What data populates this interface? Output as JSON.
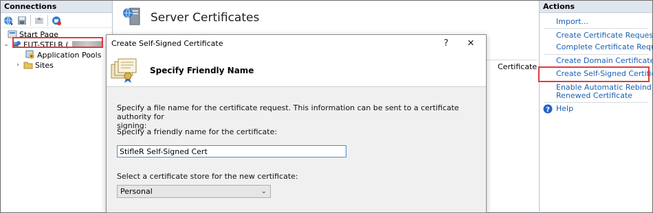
{
  "connections": {
    "header": "Connections",
    "tree": [
      {
        "label": "Start Page"
      },
      {
        "label": "FUT-STFLR ("
      },
      {
        "label": "Application Pools"
      },
      {
        "label": "Sites"
      }
    ]
  },
  "center": {
    "title": "Server Certificates",
    "column_header": "Certificate"
  },
  "actions": {
    "header": "Actions",
    "items": [
      {
        "label": "Import..."
      },
      {
        "label": "Create Certificate Request..."
      },
      {
        "label": "Complete Certificate Request..."
      },
      {
        "label": "Create Domain Certificate..."
      },
      {
        "label": "Create Self-Signed Certificate..."
      },
      {
        "label_line1": "Enable Automatic Rebind of",
        "label_line2": "Renewed Certificate"
      },
      {
        "label": "Help"
      }
    ]
  },
  "dialog": {
    "title": "Create Self-Signed Certificate",
    "help_glyph": "?",
    "close_glyph": "✕",
    "header": "Specify Friendly Name",
    "description_line1": "Specify a file name for the certificate request.  This information can be sent to a certificate authority for",
    "description_line2": "signing:",
    "friendly_name_label": "Specify a friendly name for the certificate:",
    "friendly_name_value": "StifleR Self-Signed Cert",
    "store_label": "Select a certificate store for the new certificate:",
    "store_value": "Personal"
  },
  "colors": {
    "highlight": "#e23a3a",
    "link": "#1a5fb4",
    "pane_header": "#dfe6ee"
  }
}
